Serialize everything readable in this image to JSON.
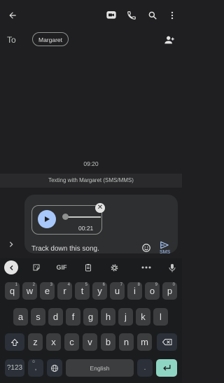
{
  "header": {
    "back_icon": "back-arrow-icon",
    "actions": [
      "video-call-icon",
      "phone-icon",
      "search-icon",
      "more-vert-icon"
    ]
  },
  "recipients": {
    "to_label": "To",
    "chip": "Margaret",
    "add_icon": "add-person-icon"
  },
  "conversation": {
    "timestamp": "09:20",
    "banner": "Texting with Margaret (SMS/MMS)"
  },
  "compose": {
    "audio": {
      "duration": "00:21",
      "progress": 0
    },
    "message": "Track down this song.",
    "send_label": "SMS",
    "emoji_icon": "emoji-icon",
    "send_icon": "send-icon",
    "expand_icon": "chevron-right-icon"
  },
  "keyboard": {
    "toolbar": {
      "back": "chevron-left-icon",
      "sticker": "sticker-icon",
      "gif": "GIF",
      "clipboard": "clipboard-icon",
      "settings": "gear-icon",
      "more": "more-horiz-icon",
      "mic": "mic-icon"
    },
    "row1": [
      {
        "k": "q",
        "h": "1"
      },
      {
        "k": "w",
        "h": "2"
      },
      {
        "k": "e",
        "h": "3"
      },
      {
        "k": "r",
        "h": "4"
      },
      {
        "k": "t",
        "h": "5"
      },
      {
        "k": "y",
        "h": "6"
      },
      {
        "k": "u",
        "h": "7"
      },
      {
        "k": "i",
        "h": "8"
      },
      {
        "k": "o",
        "h": "9"
      },
      {
        "k": "p",
        "h": "0"
      }
    ],
    "row2": [
      "a",
      "s",
      "d",
      "f",
      "g",
      "h",
      "j",
      "k",
      "l"
    ],
    "row3": [
      "z",
      "x",
      "c",
      "v",
      "b",
      "n",
      "m"
    ],
    "numbers_label": "?123",
    "comma": ",",
    "space_label": "English",
    "period": "."
  },
  "colors": {
    "accent": "#a8c7fa",
    "enter_key": "#8fd5c3",
    "background": "#1f1f21"
  }
}
